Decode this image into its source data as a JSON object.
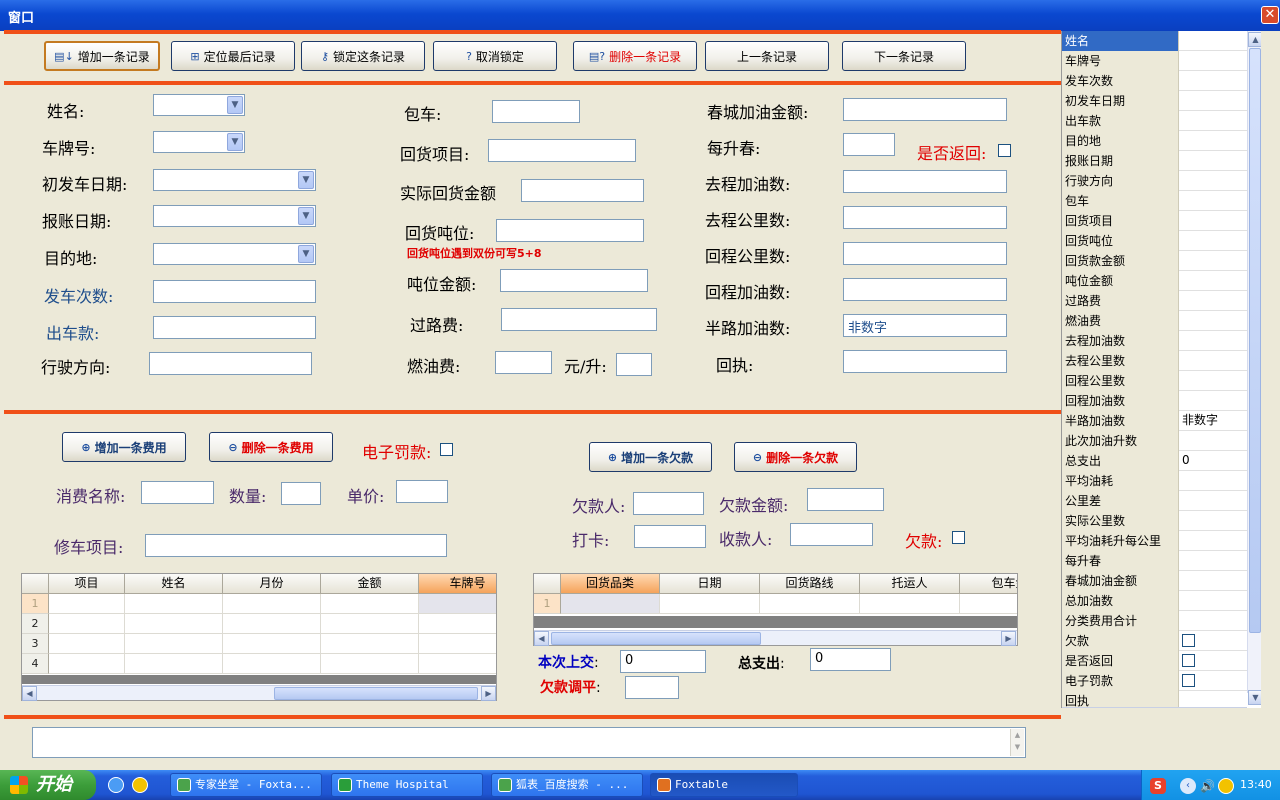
{
  "window": {
    "title": "窗口",
    "close_glyph": "✕"
  },
  "toolbar": [
    {
      "label": "增加一条记录",
      "icon": "add-record-icon",
      "glyph": "▤↓",
      "style": "normal"
    },
    {
      "label": "定位最后记录",
      "icon": "locate-last-icon",
      "glyph": "⊞",
      "style": "normal"
    },
    {
      "label": "锁定这条记录",
      "icon": "lock-icon",
      "glyph": "⚷",
      "style": "normal"
    },
    {
      "label": "取消锁定",
      "icon": "help-icon",
      "glyph": "?",
      "style": "normal"
    },
    {
      "label": "删除一条记录",
      "icon": "delete-record-icon",
      "glyph": "▤?",
      "style": "red"
    },
    {
      "label": "上一条记录",
      "icon": "",
      "glyph": "",
      "style": "normal"
    },
    {
      "label": "下一条记录",
      "icon": "",
      "glyph": "",
      "style": "normal"
    }
  ],
  "form": {
    "col1": [
      {
        "label": "姓名:",
        "type": "dropdown",
        "value": ""
      },
      {
        "label": "车牌号:",
        "type": "dropdown",
        "value": ""
      },
      {
        "label": "初发车日期:",
        "type": "dropdown",
        "value": ""
      },
      {
        "label": "报账日期:",
        "type": "dropdown",
        "value": ""
      },
      {
        "label": "目的地:",
        "type": "dropdown",
        "value": ""
      },
      {
        "label": "发车次数:",
        "type": "text",
        "value": ""
      },
      {
        "label": "出车款:",
        "type": "text",
        "value": ""
      },
      {
        "label": "行驶方向:",
        "type": "text",
        "value": ""
      }
    ],
    "col2": {
      "baoche": "包车:",
      "huohuo_xiangmu": "回货项目:",
      "shiji_huohuo": "实际回货金额",
      "huohuo_dunwei": "回货吨位:",
      "note": "回货吨位遇到双份可写5+8",
      "dunwei_jine": "吨位金额:",
      "guolu": "过路费:",
      "ranyou": "燃油费:",
      "yuan_sheng": "元/升:"
    },
    "col3": [
      {
        "label": "春城加油金额:",
        "value": ""
      },
      {
        "label": "每升春:",
        "value": ""
      },
      {
        "label": "去程加油数:",
        "value": ""
      },
      {
        "label": "去程公里数:",
        "value": ""
      },
      {
        "label": "回程公里数:",
        "value": ""
      },
      {
        "label": "回程加油数:",
        "value": ""
      },
      {
        "label": "半路加油数:",
        "value": "非数字"
      },
      {
        "label": "回执:",
        "value": ""
      }
    ],
    "fanhui_label": "是否返回:"
  },
  "lower": {
    "add_fee": "增加一条费用",
    "del_fee": "删除一条费用",
    "e_fine": "电子罚款:",
    "add_debt": "增加一条欠款",
    "del_debt": "删除一条欠款",
    "xiaofei": "消费名称:",
    "shuliang": "数量:",
    "danjia": "单价:",
    "xiuche": "修车项目:",
    "qiankuanren": "欠款人:",
    "qiankuan_jine": "欠款金额:",
    "daka": "打卡:",
    "shoukuanren": "收款人:",
    "qiankuan": "欠款:",
    "benci": "本次上交",
    "benci_val": "0",
    "zongzhichu": "总支出",
    "zongzhichu_val": "0",
    "tiaoping": "欠款调平"
  },
  "grid1": {
    "columns": [
      "项目",
      "姓名",
      "月份",
      "金额",
      "车牌号"
    ],
    "rows": [
      "1",
      "2",
      "3",
      "4"
    ]
  },
  "grid2": {
    "columns": [
      "回货品类",
      "日期",
      "回货路线",
      "托运人",
      "包车金"
    ],
    "rows": [
      "1"
    ]
  },
  "rpanel": [
    {
      "k": "姓名",
      "v": ""
    },
    {
      "k": "车牌号",
      "v": ""
    },
    {
      "k": "发车次数",
      "v": ""
    },
    {
      "k": "初发车日期",
      "v": ""
    },
    {
      "k": "出车款",
      "v": ""
    },
    {
      "k": "目的地",
      "v": ""
    },
    {
      "k": "报账日期",
      "v": ""
    },
    {
      "k": "行驶方向",
      "v": ""
    },
    {
      "k": "包车",
      "v": ""
    },
    {
      "k": "回货项目",
      "v": ""
    },
    {
      "k": "回货吨位",
      "v": ""
    },
    {
      "k": "回货款金额",
      "v": ""
    },
    {
      "k": "吨位金额",
      "v": ""
    },
    {
      "k": "过路费",
      "v": ""
    },
    {
      "k": "燃油费",
      "v": ""
    },
    {
      "k": "去程加油数",
      "v": ""
    },
    {
      "k": "去程公里数",
      "v": ""
    },
    {
      "k": "回程公里数",
      "v": ""
    },
    {
      "k": "回程加油数",
      "v": ""
    },
    {
      "k": "半路加油数",
      "v": "非数字"
    },
    {
      "k": "此次加油升数",
      "v": ""
    },
    {
      "k": "总支出",
      "v": "0"
    },
    {
      "k": "平均油耗",
      "v": ""
    },
    {
      "k": "公里差",
      "v": ""
    },
    {
      "k": "实际公里数",
      "v": ""
    },
    {
      "k": "平均油耗升每公里",
      "v": ""
    },
    {
      "k": "每升春",
      "v": ""
    },
    {
      "k": "春城加油金额",
      "v": ""
    },
    {
      "k": "总加油数",
      "v": ""
    },
    {
      "k": "分类费用合计",
      "v": ""
    },
    {
      "k": "欠款",
      "v": "",
      "cb": true
    },
    {
      "k": "是否返回",
      "v": "",
      "cb": true
    },
    {
      "k": "电子罚款",
      "v": "",
      "cb": true
    },
    {
      "k": "回执",
      "v": ""
    }
  ],
  "taskbar": {
    "start": "开始",
    "tasks": [
      {
        "label": "专家坐堂 - Foxta...",
        "icon": "ie-icon"
      },
      {
        "label": "Theme Hospital",
        "icon": "hospital-icon"
      },
      {
        "label": "狐表_百度搜索 - ...",
        "icon": "ie-icon"
      },
      {
        "label": "Foxtable",
        "icon": "foxtable-icon"
      }
    ],
    "clock": "13:40"
  }
}
